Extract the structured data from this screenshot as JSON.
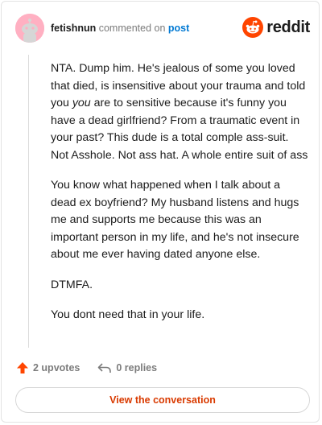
{
  "header": {
    "username": "fetishnun",
    "action_text": "commented on",
    "target_link": "post",
    "logo_text": "reddit"
  },
  "comment": {
    "p1_a": "NTA. Dump him. He's jealous of some you loved that died, is insensitive about your trauma and told you ",
    "p1_em": "you",
    "p1_b": " are to sensitive because it's funny you have a dead girlfriend? From a traumatic event in your past? This dude is a total comple ass-suit. Not Asshole. Not ass hat. A whole entire suit of ass",
    "p2": "You know what happened when I talk about a dead ex boyfriend? My husband listens and hugs me and supports me because this was an important person in my life, and he's not insecure about me ever having dated anyone else.",
    "p3": "DTMFA.",
    "p4": "You dont need that in your life."
  },
  "actions": {
    "upvotes": "2 upvotes",
    "replies": "0 replies"
  },
  "cta": {
    "label": "View the conversation"
  },
  "colors": {
    "brand": "#ff4500",
    "link": "#0079d3",
    "cta_text": "#d93a00"
  }
}
